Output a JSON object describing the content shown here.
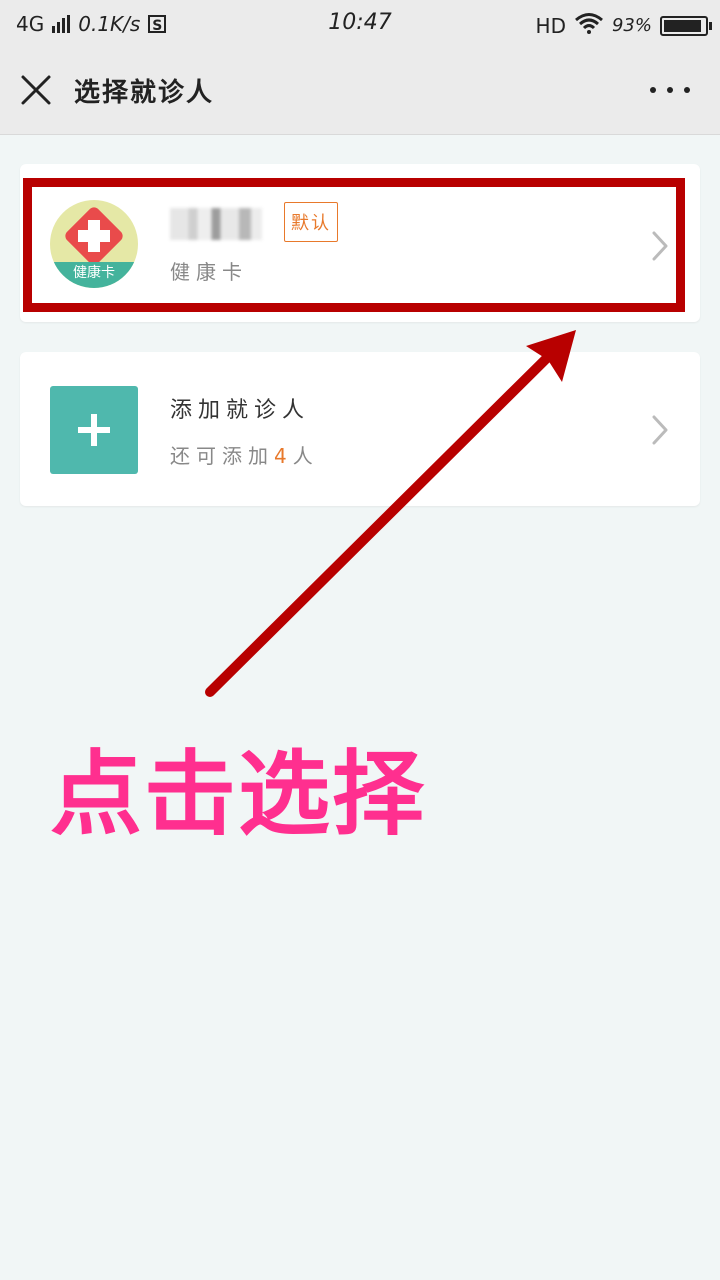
{
  "status_bar": {
    "network": "4G",
    "speed": "0.1K/s",
    "s_badge": "S",
    "time": "10:47",
    "hd": "HD",
    "battery": "93%",
    "battery_level": 0.93
  },
  "header": {
    "title": "选择就诊人",
    "close_icon": "close-icon",
    "more_icon": "more-icon"
  },
  "patient_card": {
    "name": "",
    "default_badge": "默认",
    "card_type": "健康卡",
    "avatar_band": "健康卡"
  },
  "add_card": {
    "title": "添加就诊人",
    "sub_prefix": "还可添加",
    "count": "4",
    "sub_suffix": "人"
  },
  "annotation": {
    "text": "点击选择",
    "color": "#ff2f8f",
    "arrow_color": "#b80000"
  },
  "colors": {
    "accent": "#4fb8ad",
    "badge": "#e8792b",
    "background": "#f1f6f6"
  }
}
